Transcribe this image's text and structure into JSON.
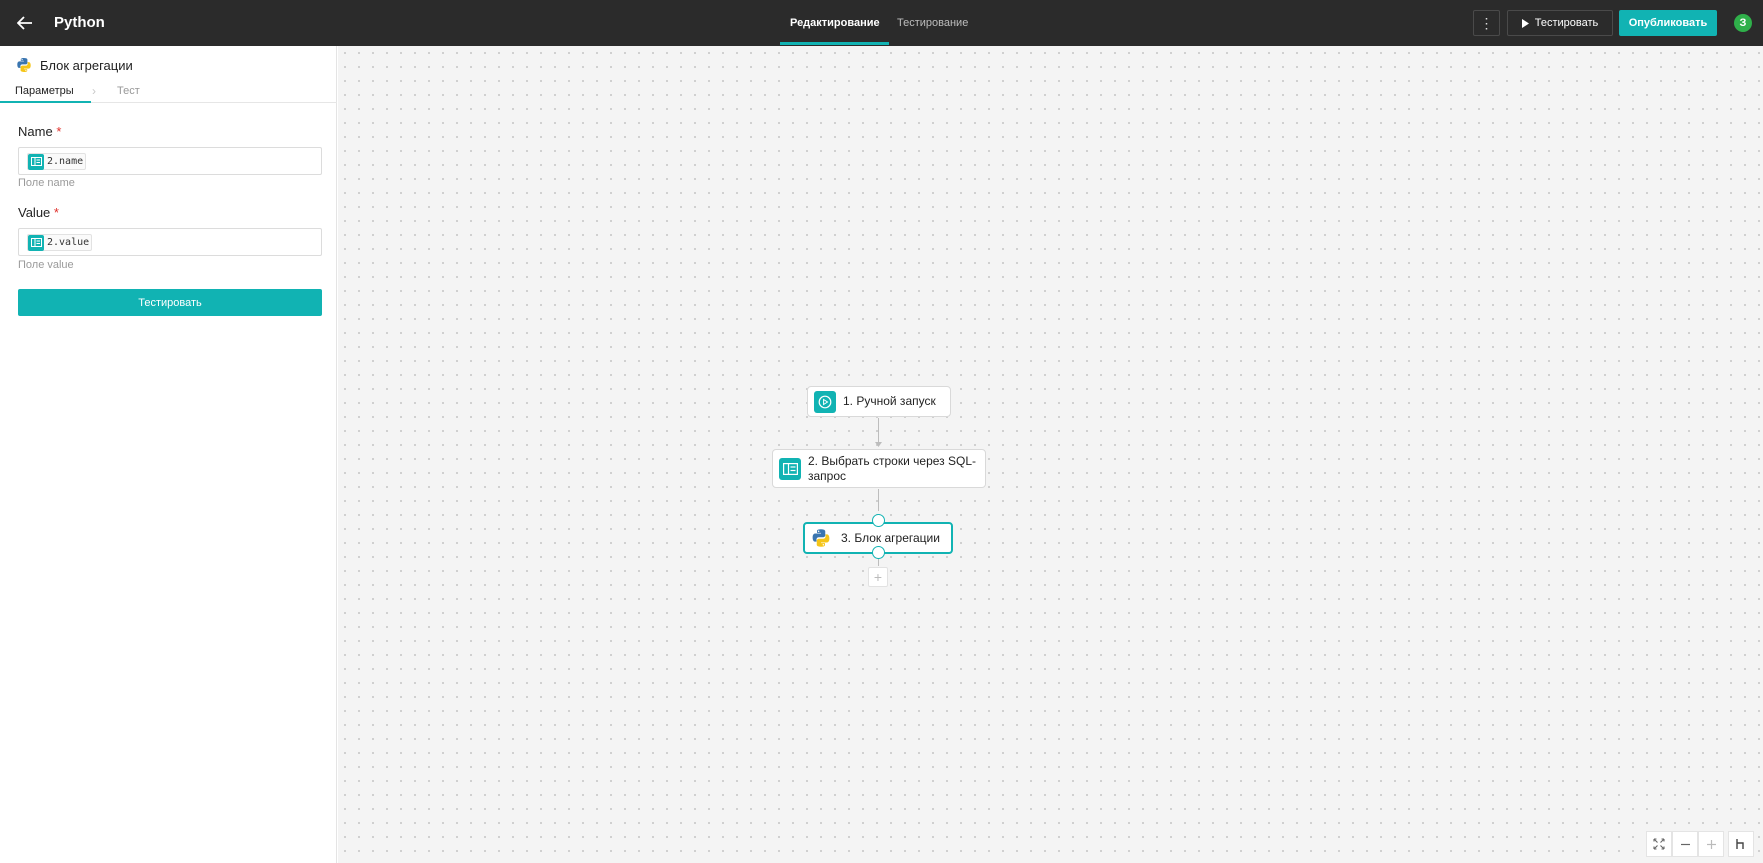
{
  "header": {
    "title": "Python",
    "tabs": [
      {
        "label": "Редактирование",
        "active": true
      },
      {
        "label": "Тестирование",
        "active": false
      }
    ],
    "more_label": "⋮",
    "test_button": "Тестировать",
    "publish_button": "Опубликовать",
    "user_initial": "З",
    "accent_color": "#11b3b3"
  },
  "panel": {
    "title": "Блок агрегации",
    "tabs": [
      {
        "label": "Параметры",
        "active": true
      },
      {
        "label": "Тест",
        "active": false
      }
    ],
    "fields": [
      {
        "label": "Name",
        "required_mark": "*",
        "value": "2.name",
        "hint": "Поле name"
      },
      {
        "label": "Value",
        "required_mark": "*",
        "value": "2.value",
        "hint": "Поле value"
      }
    ],
    "test_button": "Тестировать"
  },
  "canvas": {
    "nodes": [
      {
        "label": "1. Ручной запуск",
        "icon": "play-circle-icon"
      },
      {
        "label": "2. Выбрать строки через SQL-запрос",
        "icon": "table-icon"
      },
      {
        "label": "3. Блок агрегации",
        "icon": "python-icon",
        "selected": true
      }
    ],
    "add_label": "+",
    "zoom_controls": [
      "fit-view-icon",
      "zoom-out-icon",
      "zoom-in-icon",
      "layout-icon"
    ]
  }
}
